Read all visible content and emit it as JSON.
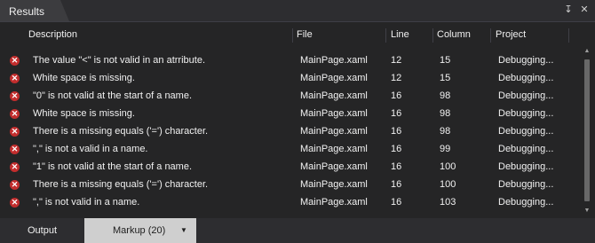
{
  "panel": {
    "title": "Results"
  },
  "titlebar_icons": {
    "pin": "pin-icon",
    "close": "close-icon"
  },
  "columns": {
    "description": "Description",
    "file": "File",
    "line": "Line",
    "column": "Column",
    "project": "Project"
  },
  "rows": [
    {
      "description": "The value \"<\" is not valid in an atrribute.",
      "file": "MainPage.xaml",
      "line": "12",
      "column": "15",
      "project": "Debugging..."
    },
    {
      "description": "White space is missing.",
      "file": "MainPage.xaml",
      "line": "12",
      "column": "15",
      "project": "Debugging..."
    },
    {
      "description": "\"0\" is not valid at the start of a name.",
      "file": "MainPage.xaml",
      "line": "16",
      "column": "98",
      "project": "Debugging..."
    },
    {
      "description": "White space is missing.",
      "file": "MainPage.xaml",
      "line": "16",
      "column": "98",
      "project": "Debugging..."
    },
    {
      "description": "There is a missing equals ('=') character.",
      "file": "MainPage.xaml",
      "line": "16",
      "column": "98",
      "project": "Debugging..."
    },
    {
      "description": "\",\" is not a valid in a name.",
      "file": "MainPage.xaml",
      "line": "16",
      "column": "99",
      "project": "Debugging..."
    },
    {
      "description": "\"1\" is not valid at the start of a name.",
      "file": "MainPage.xaml",
      "line": "16",
      "column": "100",
      "project": "Debugging..."
    },
    {
      "description": "There is a missing equals ('=') character.",
      "file": "MainPage.xaml",
      "line": "16",
      "column": "100",
      "project": "Debugging..."
    },
    {
      "description": "\",\" is not valid in a name.",
      "file": "MainPage.xaml",
      "line": "16",
      "column": "103",
      "project": "Debugging..."
    }
  ],
  "tabs": {
    "output": "Output",
    "markup": "Markup (20)"
  },
  "colors": {
    "error": "#c22d2d",
    "background": "#252526",
    "tab_active": "#cfcfcf"
  }
}
